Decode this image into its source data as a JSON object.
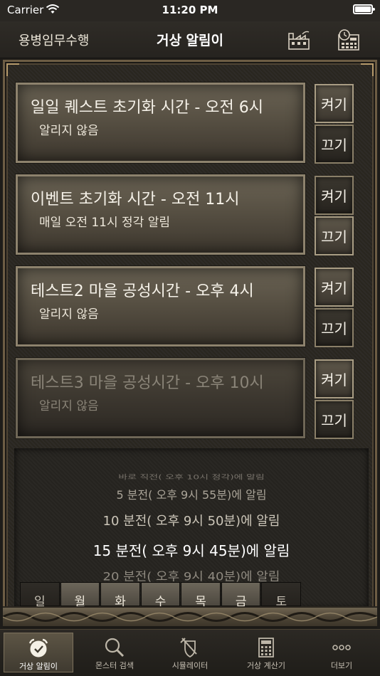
{
  "status_bar": {
    "carrier": "Carrier",
    "time": "11:20 PM"
  },
  "nav": {
    "back_label": "용병임무수행",
    "title": "거상 알림이"
  },
  "alarms": [
    {
      "title": "일일 퀘스트 초기화 시간 - 오전 6시",
      "subtitle": "알리지 않음",
      "on_label": "켜기",
      "off_label": "끄기",
      "enabled": true
    },
    {
      "title": "이벤트 초기화 시간 - 오전 11시",
      "subtitle": "매일 오전 11시 정각 알림",
      "on_label": "켜기",
      "off_label": "끄기",
      "enabled": true
    },
    {
      "title": "테스트2 마을 공성시간 - 오후 4시",
      "subtitle": "알리지 않음",
      "on_label": "켜기",
      "off_label": "끄기",
      "enabled": true
    },
    {
      "title": "테스트3 마을 공성시간 - 오후 10시",
      "subtitle": "알리지 않음",
      "on_label": "켜기",
      "off_label": "끄기",
      "enabled": false
    }
  ],
  "picker": {
    "options": [
      "바로 직전( 오후 10시 정각)에 알림",
      "5 분전( 오후 9시 55분)에 알림",
      "10 분전( 오후 9시 50분)에 알림",
      "15 분전( 오후 9시 45분)에 알림",
      "20 분전( 오후 9시 40분)에 알림"
    ],
    "selected": "15 분전( 오후 9시 45분)에 알림"
  },
  "days": [
    "일",
    "월",
    "화",
    "수",
    "목",
    "금",
    "토"
  ],
  "tabs": [
    {
      "label": "거상 알림이",
      "icon": "alarm-clock-icon",
      "active": true
    },
    {
      "label": "몬스터 검색",
      "icon": "search-icon",
      "active": false
    },
    {
      "label": "시뮬레이터",
      "icon": "sword-shield-icon",
      "active": false
    },
    {
      "label": "거상 계산기",
      "icon": "calculator-icon",
      "active": false
    },
    {
      "label": "더보기",
      "icon": "more-icon",
      "active": false
    }
  ]
}
